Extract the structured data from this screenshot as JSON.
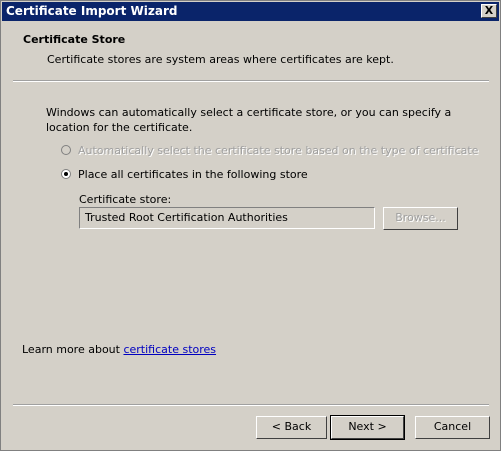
{
  "window": {
    "title": "Certificate Import Wizard",
    "close_glyph": "X"
  },
  "header": {
    "title": "Certificate Store",
    "subtitle": "Certificate stores are system areas where certificates are kept."
  },
  "body": {
    "intro": "Windows can automatically select a certificate store, or you can specify a location for the certificate.",
    "radio_auto": {
      "label": "Automatically select the certificate store based on the type of certificate",
      "selected": false,
      "enabled": false
    },
    "radio_manual": {
      "label": "Place all certificates in the following store",
      "selected": true,
      "enabled": true
    },
    "store_label": "Certificate store:",
    "store_value": "Trusted Root Certification Authorities",
    "browse_label": "Browse..."
  },
  "learn_more": {
    "prefix": "Learn more about ",
    "link_text": "certificate stores"
  },
  "buttons": {
    "back": "< Back",
    "next": "Next >",
    "cancel": "Cancel"
  },
  "colors": {
    "titlebar": "#0a246a",
    "face": "#d4d0c8",
    "link": "#0000c0"
  }
}
